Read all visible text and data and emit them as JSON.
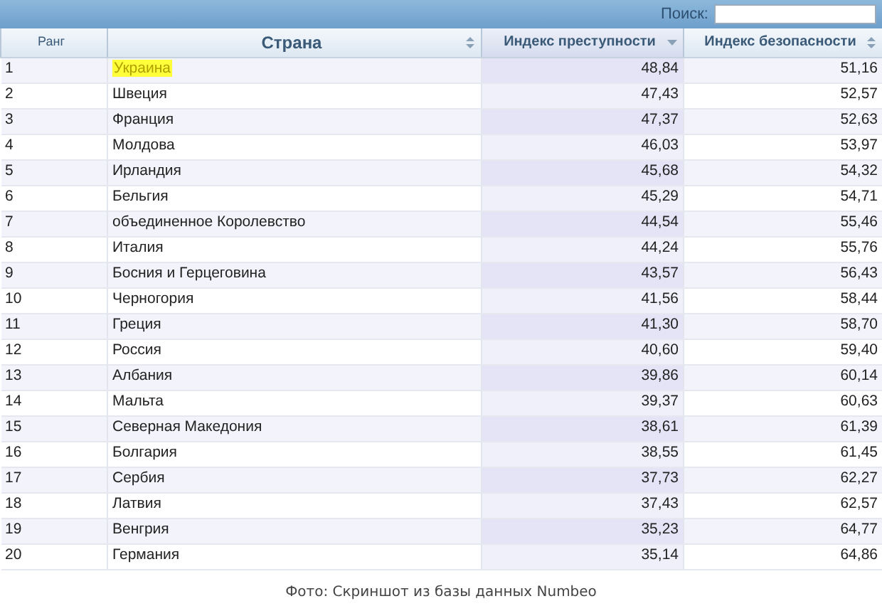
{
  "toolbar": {
    "search": {
      "label": "Поиск:"
    }
  },
  "table": {
    "columns": [
      {
        "label": "Ранг",
        "sorted": false,
        "sortable": false
      },
      {
        "label": "Страна",
        "sorted": false,
        "sortable": true
      },
      {
        "label": "Индекс преступности",
        "sorted": true,
        "sortable": true
      },
      {
        "label": "Индекс безопасности",
        "sorted": false,
        "sortable": true
      }
    ],
    "rows": [
      {
        "cells": [
          "1",
          "Украина",
          "48,84",
          "51,16"
        ],
        "highlighted": true
      },
      {
        "cells": [
          "2",
          "Швеция",
          "47,43",
          "52,57"
        ],
        "highlighted": false
      },
      {
        "cells": [
          "3",
          "Франция",
          "47,37",
          "52,63"
        ],
        "highlighted": false
      },
      {
        "cells": [
          "4",
          "Молдова",
          "46,03",
          "53,97"
        ],
        "highlighted": false
      },
      {
        "cells": [
          "5",
          "Ирландия",
          "45,68",
          "54,32"
        ],
        "highlighted": false
      },
      {
        "cells": [
          "6",
          "Бельгия",
          "45,29",
          "54,71"
        ],
        "highlighted": false
      },
      {
        "cells": [
          "7",
          "объединенное Королевство",
          "44,54",
          "55,46"
        ],
        "highlighted": false
      },
      {
        "cells": [
          "8",
          "Италия",
          "44,24",
          "55,76"
        ],
        "highlighted": false
      },
      {
        "cells": [
          "9",
          "Босния и Герцеговина",
          "43,57",
          "56,43"
        ],
        "highlighted": false
      },
      {
        "cells": [
          "10",
          "Черногория",
          "41,56",
          "58,44"
        ],
        "highlighted": false
      },
      {
        "cells": [
          "11",
          "Греция",
          "41,30",
          "58,70"
        ],
        "highlighted": false
      },
      {
        "cells": [
          "12",
          "Россия",
          "40,60",
          "59,40"
        ],
        "highlighted": false
      },
      {
        "cells": [
          "13",
          "Албания",
          "39,86",
          "60,14"
        ],
        "highlighted": false
      },
      {
        "cells": [
          "14",
          "Мальта",
          "39,37",
          "60,63"
        ],
        "highlighted": false
      },
      {
        "cells": [
          "15",
          "Северная Македония",
          "38,61",
          "61,39"
        ],
        "highlighted": false
      },
      {
        "cells": [
          "16",
          "Болгария",
          "38,55",
          "61,45"
        ],
        "highlighted": false
      },
      {
        "cells": [
          "17",
          "Сербия",
          "37,73",
          "62,27"
        ],
        "highlighted": false
      },
      {
        "cells": [
          "18",
          "Латвия",
          "37,43",
          "62,57"
        ],
        "highlighted": false
      },
      {
        "cells": [
          "19",
          "Венгрия",
          "35,23",
          "64,77"
        ],
        "highlighted": false
      },
      {
        "cells": [
          "20",
          "Германия",
          "35,14",
          "64,86"
        ],
        "highlighted": false
      }
    ]
  },
  "caption": "Фото: Скриншот из базы данных Numbeo"
}
